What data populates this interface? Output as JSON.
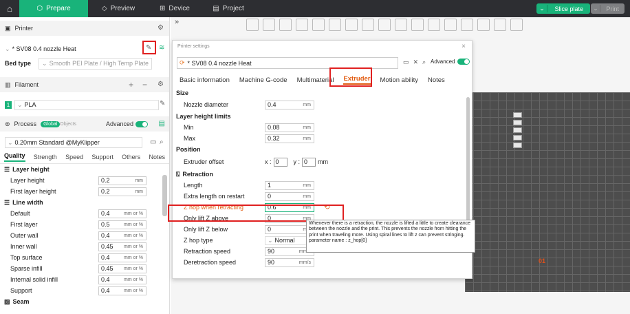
{
  "topbar": {
    "tabs": [
      {
        "label": "Prepare",
        "icon": "cube-icon"
      },
      {
        "label": "Preview",
        "icon": "layers-icon"
      },
      {
        "label": "Device",
        "icon": "device-icon"
      },
      {
        "label": "Project",
        "icon": "project-icon"
      }
    ],
    "slice_label": "Slice plate",
    "print_label": "Print"
  },
  "left": {
    "printer_header": "Printer",
    "printer_preset": "* SV08 0.4 nozzle Heat",
    "bed_type_label": "Bed type",
    "bed_type_value": "Smooth PEI Plate / High Temp Plate",
    "filament_header": "Filament",
    "filament_index": "1",
    "filament_value": "PLA",
    "process_header": "Process",
    "process_global": "Global",
    "process_objects": "Objects",
    "advanced_label": "Advanced",
    "process_preset": "0.20mm Standard @MyKlipper",
    "quality_tabs": [
      "Quality",
      "Strength",
      "Speed",
      "Support",
      "Others",
      "Notes"
    ],
    "groups": {
      "layer_height": "Layer height",
      "line_width": "Line width",
      "seam": "Seam"
    },
    "layer_rows": [
      {
        "label": "Layer height",
        "value": "0.2",
        "unit": "mm"
      },
      {
        "label": "First layer height",
        "value": "0.2",
        "unit": "mm"
      }
    ],
    "line_rows": [
      {
        "label": "Default",
        "value": "0.4",
        "unit": "mm or %"
      },
      {
        "label": "First layer",
        "value": "0.5",
        "unit": "mm or %"
      },
      {
        "label": "Outer wall",
        "value": "0.4",
        "unit": "mm or %"
      },
      {
        "label": "Inner wall",
        "value": "0.45",
        "unit": "mm or %"
      },
      {
        "label": "Top surface",
        "value": "0.4",
        "unit": "mm or %"
      },
      {
        "label": "Sparse infill",
        "value": "0.45",
        "unit": "mm or %"
      },
      {
        "label": "Internal solid infill",
        "value": "0.4",
        "unit": "mm or %"
      },
      {
        "label": "Support",
        "value": "0.4",
        "unit": "mm or %"
      }
    ]
  },
  "canvas": {
    "collapse": "»",
    "plate_number": "01"
  },
  "dialog": {
    "title": "Printer settings",
    "close": "×",
    "preset": "* SV08 0.4 nozzle Heat",
    "advanced_label": "Advanced",
    "tabs": [
      "Basic information",
      "Machine G-code",
      "Multimaterial",
      "Extruder",
      "Motion ability",
      "Notes"
    ],
    "active_tab": "Extruder",
    "size_group": "Size",
    "nozzle_label": "Nozzle diameter",
    "nozzle_value": "0.4",
    "nozzle_unit": "mm",
    "lh_group": "Layer height limits",
    "min_label": "Min",
    "min_value": "0.08",
    "max_label": "Max",
    "max_value": "0.32",
    "unit_mm": "mm",
    "pos_group": "Position",
    "offset_label": "Extruder offset",
    "offset_x_label": "x :",
    "offset_x": "0",
    "offset_y_label": "y :",
    "offset_y": "0",
    "offset_unit": "mm",
    "ret_group": "Retraction",
    "length_label": "Length",
    "length_value": "1",
    "extra_label": "Extra length on restart",
    "extra_value": "0",
    "zhop_label": "Z hop when retracting",
    "zhop_value": "0.6",
    "lift_above_label": "Only lift Z above",
    "lift_above_value": "0",
    "lift_below_label": "Only lift Z below",
    "lift_below_value": "0",
    "zhop_type_label": "Z hop type",
    "zhop_type_value": "Normal",
    "ret_speed_label": "Retraction speed",
    "ret_speed_value": "90",
    "deret_label": "Deretraction speed",
    "deret_value": "90",
    "speed_unit": "mm/s",
    "tooltip_text": "Whenever there is a retraction, the nozzle is lifted a little to create clearance between the nozzle and the print. This prevents the nozzle from hitting the print when traveling more. Using spiral lines to lift z can prevent stringing.",
    "tooltip_param": "parameter name    : z_hop[0]"
  },
  "colors": {
    "accent": "#19b37a",
    "highlight": "#e02020",
    "orange": "#e25b10"
  }
}
